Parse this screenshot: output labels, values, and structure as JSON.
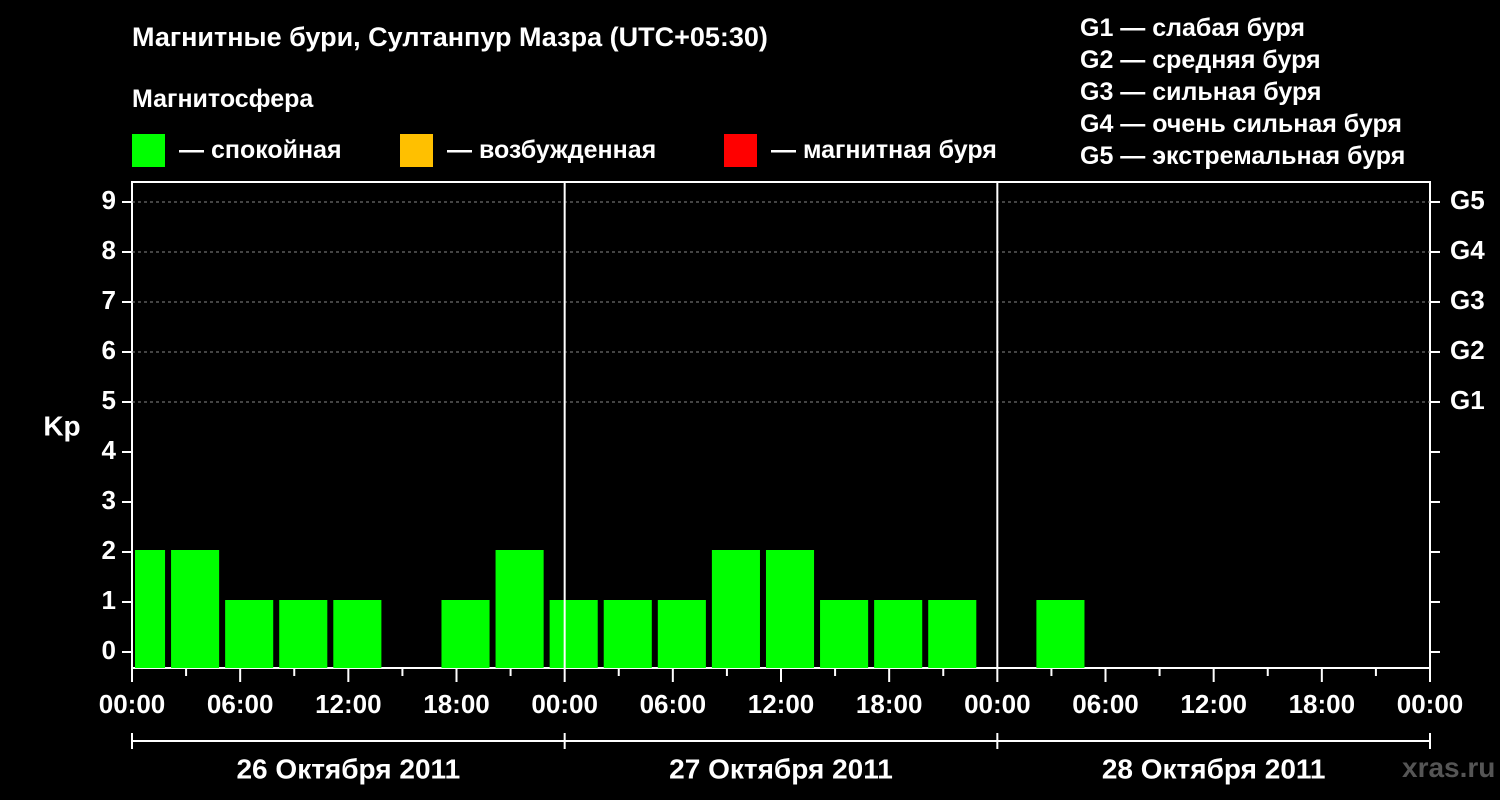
{
  "header": {
    "title": "Магнитные бури, Султанпур Мазра (UTC+05:30)",
    "legend_title": "Магнитосфера"
  },
  "legend": [
    {
      "color": "#00ff00",
      "label": "— спокойная"
    },
    {
      "color": "#ffc000",
      "label": "— возбужденная"
    },
    {
      "color": "#ff0000",
      "label": "— магнитная буря"
    }
  ],
  "g_scale": [
    "G1 — слабая буря",
    "G2 — средняя буря",
    "G3 — сильная буря",
    "G4 — очень сильная буря",
    "G5 — экстремальная буря"
  ],
  "watermark": "xras.ru",
  "chart_data": {
    "type": "bar",
    "ylabel": "Kp",
    "ylim": [
      0,
      9
    ],
    "yticks": [
      "0",
      "1",
      "2",
      "3",
      "4",
      "5",
      "6",
      "7",
      "8",
      "9"
    ],
    "right_axis_labels": [
      {
        "kp": 5,
        "label": "G1"
      },
      {
        "kp": 6,
        "label": "G2"
      },
      {
        "kp": 7,
        "label": "G3"
      },
      {
        "kp": 8,
        "label": "G4"
      },
      {
        "kp": 9,
        "label": "G5"
      }
    ],
    "grid": "dashed horizontal at Kp 5–9",
    "xtick_labels": [
      "00:00",
      "06:00",
      "12:00",
      "18:00",
      "00:00",
      "06:00",
      "12:00",
      "18:00",
      "00:00",
      "06:00",
      "12:00",
      "18:00",
      "00:00"
    ],
    "days": [
      "26 Октября 2011",
      "27 Октября 2011",
      "28 Октября 2011"
    ],
    "bar_color": "#00ff00",
    "bars": [
      {
        "day": 0,
        "start_hour": 0,
        "end_hour": 2,
        "kp": 2
      },
      {
        "day": 0,
        "start_hour": 2,
        "end_hour": 5,
        "kp": 2
      },
      {
        "day": 0,
        "start_hour": 5,
        "end_hour": 8,
        "kp": 1
      },
      {
        "day": 0,
        "start_hour": 8,
        "end_hour": 11,
        "kp": 1
      },
      {
        "day": 0,
        "start_hour": 11,
        "end_hour": 14,
        "kp": 1
      },
      {
        "day": 0,
        "start_hour": 17,
        "end_hour": 20,
        "kp": 1
      },
      {
        "day": 0,
        "start_hour": 20,
        "end_hour": 23,
        "kp": 2
      },
      {
        "day": 0,
        "start_hour": 23,
        "end_hour": 26,
        "kp": 1
      },
      {
        "day": 1,
        "start_hour": 2,
        "end_hour": 5,
        "kp": 1
      },
      {
        "day": 1,
        "start_hour": 5,
        "end_hour": 8,
        "kp": 1
      },
      {
        "day": 1,
        "start_hour": 8,
        "end_hour": 11,
        "kp": 2
      },
      {
        "day": 1,
        "start_hour": 11,
        "end_hour": 14,
        "kp": 2
      },
      {
        "day": 1,
        "start_hour": 14,
        "end_hour": 17,
        "kp": 1
      },
      {
        "day": 1,
        "start_hour": 17,
        "end_hour": 20,
        "kp": 1
      },
      {
        "day": 1,
        "start_hour": 20,
        "end_hour": 23,
        "kp": 1
      },
      {
        "day": 2,
        "start_hour": 2,
        "end_hour": 5,
        "kp": 1
      }
    ]
  }
}
